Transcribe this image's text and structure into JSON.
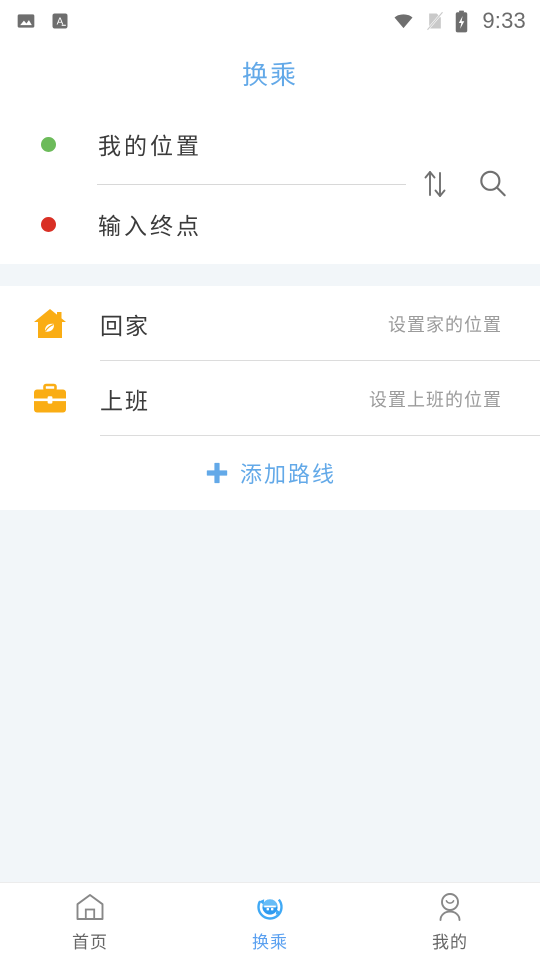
{
  "status_bar": {
    "notifications": [
      "image-notification-icon",
      "translate-notification-icon"
    ],
    "wifi_icon": "wifi-icon",
    "sim_icon": "no-sim-icon",
    "battery_icon": "battery-charging-icon",
    "time": "9:33"
  },
  "header": {
    "title": "换乘",
    "title_color": "#63A9E8"
  },
  "route": {
    "start": {
      "dot_icon": "green-dot-icon",
      "dot_color": "#6CBB5A",
      "value": "我的位置"
    },
    "end": {
      "dot_icon": "red-dot-icon",
      "dot_color": "#D93025",
      "placeholder": "输入终点",
      "value": "输入终点"
    },
    "swap_icon": "swap-vertical-icon",
    "search_icon": "search-icon"
  },
  "shortcuts": {
    "items": [
      {
        "icon": "home-house-icon",
        "icon_color": "#FAAD14",
        "label": "回家",
        "hint": "设置家的位置"
      },
      {
        "icon": "work-briefcase-icon",
        "icon_color": "#FAAD14",
        "label": "上班",
        "hint": "设置上班的位置"
      }
    ],
    "add_route": {
      "icon": "plus-icon",
      "label": "添加路线",
      "color": "#63A9E8"
    }
  },
  "bottom_nav": {
    "active_color": "#5AA0F0",
    "inactive_color": "#666666",
    "items": [
      {
        "icon": "home-outline-icon",
        "label": "首页",
        "active": false
      },
      {
        "icon": "transfer-circle-icon",
        "label": "换乘",
        "active": true
      },
      {
        "icon": "person-outline-icon",
        "label": "我的",
        "active": false
      }
    ]
  }
}
